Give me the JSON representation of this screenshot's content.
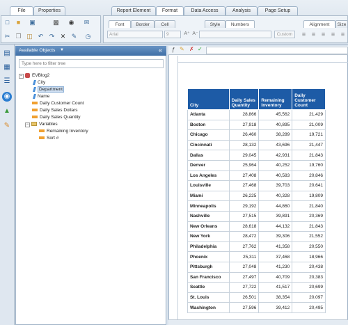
{
  "top_tabs": {
    "left": [
      "File",
      "Properties"
    ],
    "right": [
      "Report Element",
      "Format",
      "Data Access",
      "Analysis",
      "Page Setup"
    ]
  },
  "sub_tabs": [
    "Font",
    "Border",
    "Cell",
    "Style",
    "Numbers",
    "Alignment",
    "Size"
  ],
  "font": {
    "name": "Arial",
    "size": "9"
  },
  "custom_button": "Custom",
  "panel": {
    "title": "Available Objects",
    "filter_placeholder": "Type here to filter tree",
    "collapse_label": "«"
  },
  "tree": {
    "root": "EVBlog2",
    "items": [
      "City",
      "Department",
      "Name",
      "Daily Customer Count",
      "Daily Sales Dollars",
      "Daily Sales Quantity"
    ],
    "variables_folder": "Variables",
    "variables": [
      "Remaining Inventory",
      "Sort #"
    ]
  },
  "table": {
    "headers": [
      "City",
      "Daily Sales Quantity",
      "Remaining Inventory",
      "Daily Customer Count"
    ],
    "rows": [
      [
        "Atlanta",
        "28,866",
        "45,562",
        "21,429"
      ],
      [
        "Boston",
        "27,918",
        "40,895",
        "21,009"
      ],
      [
        "Chicago",
        "26,460",
        "38,289",
        "19,721"
      ],
      [
        "Cincinnati",
        "28,132",
        "43,696",
        "21,447"
      ],
      [
        "Dallas",
        "29,045",
        "42,931",
        "21,843"
      ],
      [
        "Denver",
        "25,964",
        "40,252",
        "19,760"
      ],
      [
        "Los Angeles",
        "27,408",
        "40,583",
        "20,846"
      ],
      [
        "Louisville",
        "27,468",
        "39,703",
        "20,641"
      ],
      [
        "Miami",
        "26,225",
        "40,328",
        "19,809"
      ],
      [
        "Minneapolis",
        "29,192",
        "44,860",
        "21,840"
      ],
      [
        "Nashville",
        "27,515",
        "39,891",
        "20,369"
      ],
      [
        "New Orleans",
        "28,618",
        "44,132",
        "21,843"
      ],
      [
        "New York",
        "28,472",
        "39,306",
        "21,552"
      ],
      [
        "Philadelphia",
        "27,762",
        "41,358",
        "20,550"
      ],
      [
        "Phoenix",
        "25,311",
        "37,468",
        "18,966"
      ],
      [
        "Pittsburgh",
        "27,048",
        "41,230",
        "20,438"
      ],
      [
        "San Francisco",
        "27,497",
        "40,709",
        "20,383"
      ],
      [
        "Seattle",
        "27,722",
        "41,517",
        "20,699"
      ],
      [
        "St. Louis",
        "26,501",
        "38,354",
        "20,097"
      ],
      [
        "Washington",
        "27,596",
        "39,412",
        "20,495"
      ]
    ]
  }
}
